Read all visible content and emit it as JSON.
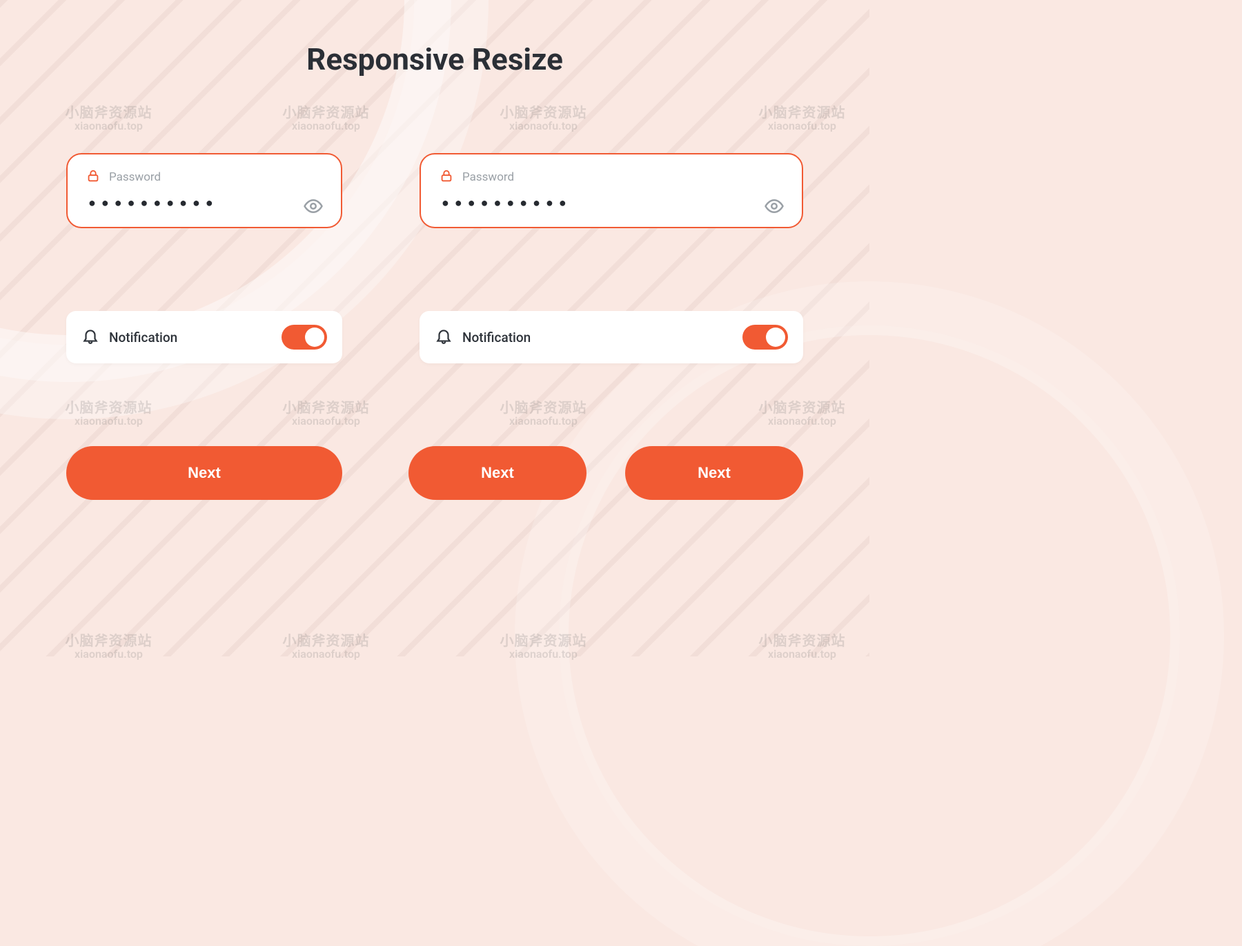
{
  "title": "Responsive Resize",
  "password_field": {
    "label": "Password",
    "masked_value": "●●●●●●●●●●"
  },
  "notification": {
    "label": "Notification",
    "enabled": true
  },
  "buttons": {
    "next": "Next"
  },
  "watermark": {
    "line1": "小脑斧资源站",
    "line2": "xiaonaofu.top"
  },
  "colors": {
    "accent": "#f15a33",
    "bg": "#fae8e2",
    "text_dark": "#2b2f36",
    "text_muted": "#9aa0a6"
  }
}
